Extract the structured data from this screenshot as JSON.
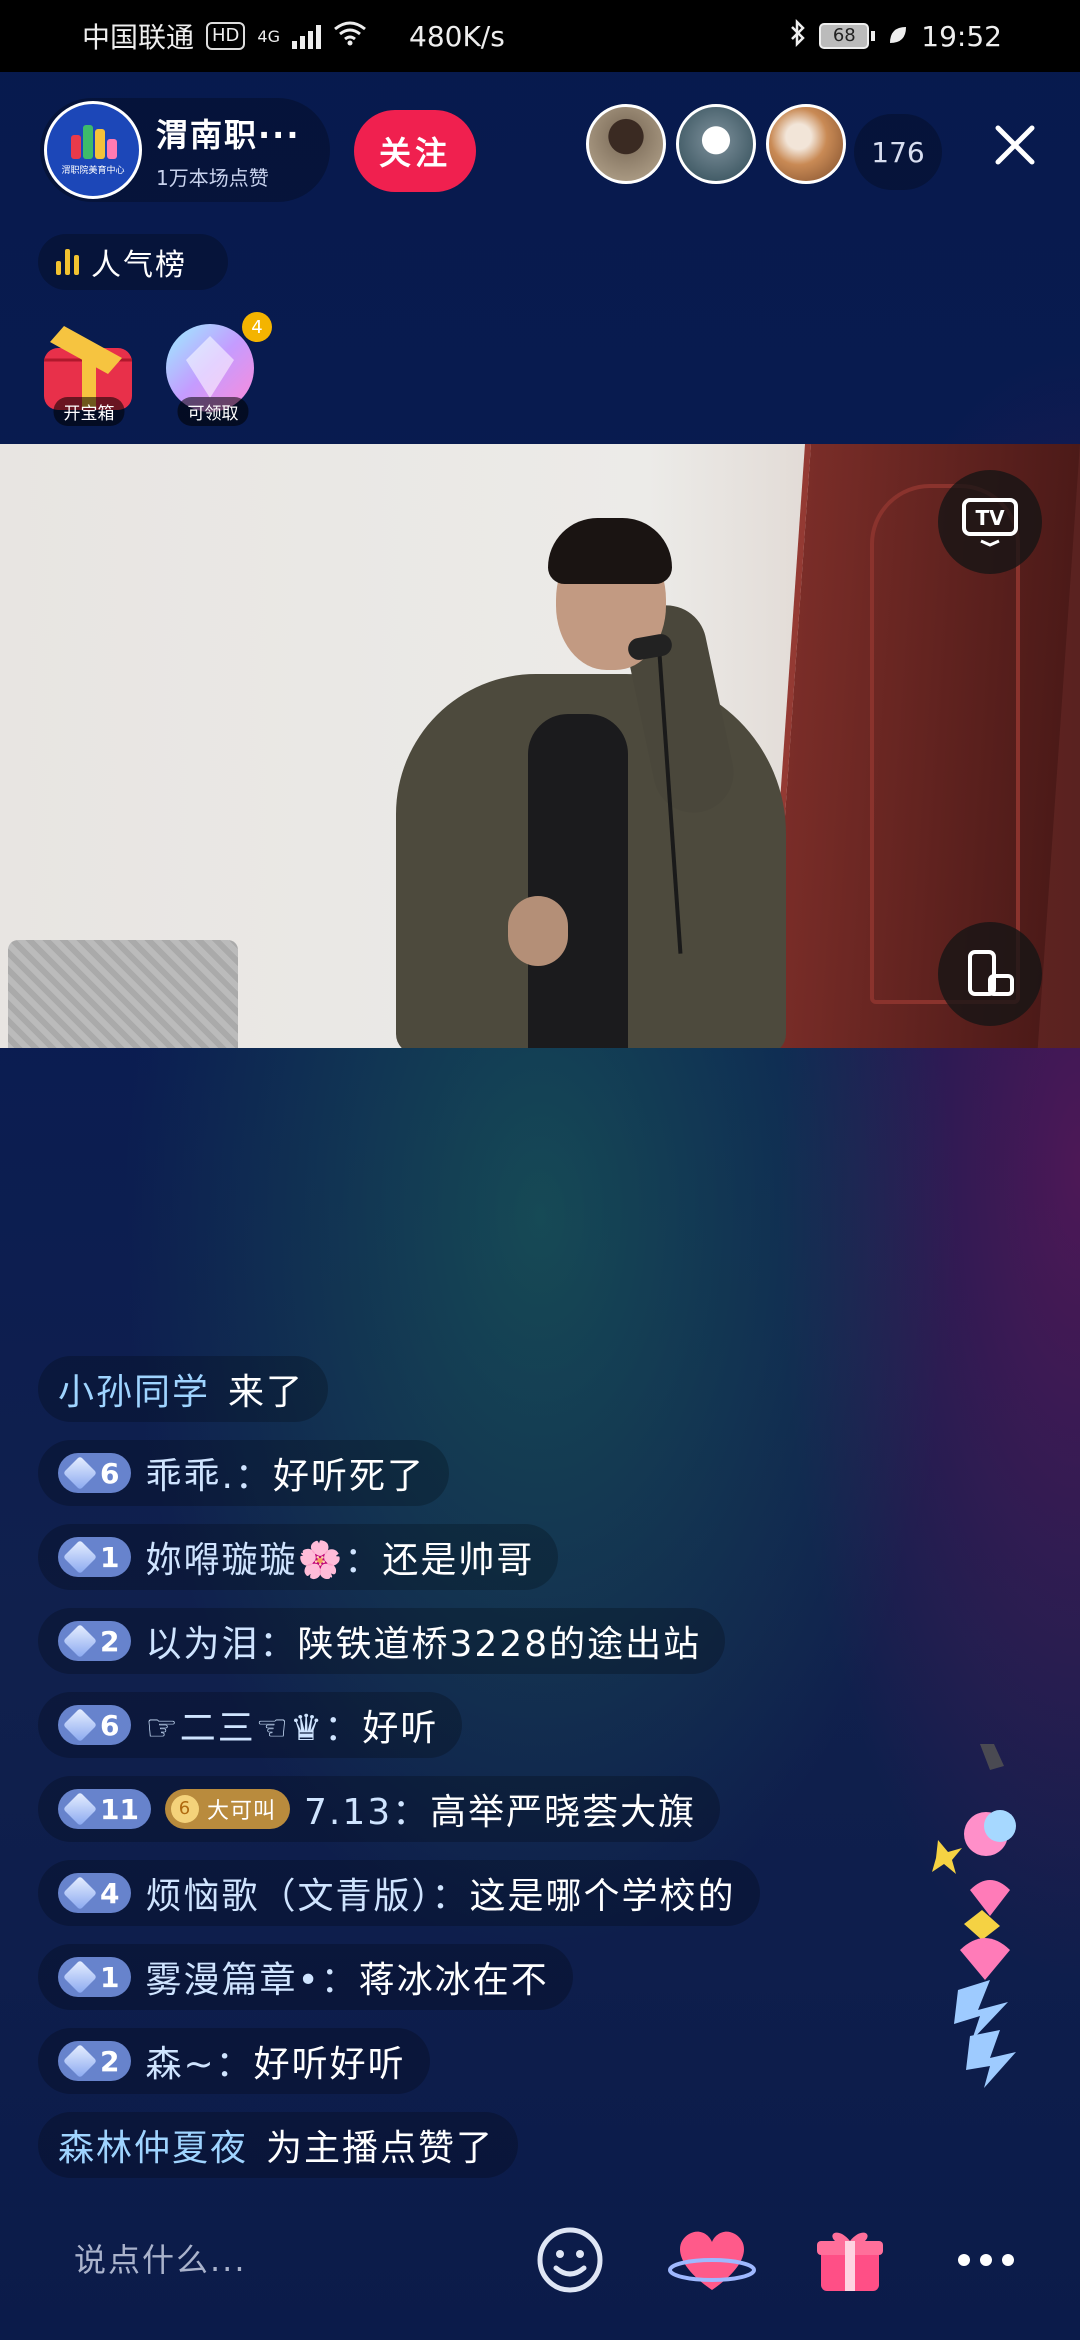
{
  "status_bar": {
    "carrier": "中国联通",
    "hd": "HD",
    "network": "4G",
    "speed": "480K/s",
    "battery": "68",
    "time": "19:52"
  },
  "header": {
    "host_name": "渭南职···",
    "host_likes": "1万本场点赞",
    "host_avatar_text": "渭职院美育中心",
    "follow_label": "关注",
    "viewer_count": "176"
  },
  "rank": {
    "label": "人气榜"
  },
  "boxes": [
    {
      "label": "开宝箱"
    },
    {
      "label": "可领取",
      "badge": "4"
    }
  ],
  "chat": {
    "faded": "",
    "messages": [
      {
        "type": "system",
        "nick": "小孙同学",
        "action": "来了"
      },
      {
        "type": "msg",
        "level": "6",
        "nick": "乖乖.：",
        "text": "好听死了"
      },
      {
        "type": "msg",
        "level": "1",
        "nick": "妳嘚璇璇🌸：",
        "text": "还是帅哥"
      },
      {
        "type": "msg",
        "level": "2",
        "nick": "以为泪：",
        "text": "陕铁道桥3228的途出站"
      },
      {
        "type": "msg",
        "level": "6",
        "nick": "☞二三☜♛：",
        "text": "好听"
      },
      {
        "type": "fan",
        "level": "11",
        "fan_level": "6",
        "fan_name": "大可叫",
        "nick": "7.13：",
        "text": "高举严晓荟大旗"
      },
      {
        "type": "msg",
        "level": "4",
        "nick": "烦恼歌（文青版）：",
        "text": "这是哪个学校的"
      },
      {
        "type": "msg",
        "level": "1",
        "nick": "雾漫篇章•：",
        "text": "蒋冰冰在不"
      },
      {
        "type": "msg",
        "level": "2",
        "nick": "森~：",
        "text": "好听好听"
      },
      {
        "type": "system",
        "nick": "森林仲夏夜",
        "action": "为主播点赞了"
      }
    ]
  },
  "bottom": {
    "input_placeholder": "说点什么..."
  },
  "icons": {
    "close": "close-icon",
    "tv": "tv-cast-icon",
    "rotate": "screen-rotate-icon",
    "emoji": "emoji-icon",
    "like": "heart-planet-icon",
    "gift": "gift-icon",
    "more": "more-icon"
  },
  "colors": {
    "follow": "#f0204f",
    "level_badge": "#7896e6",
    "rank_bars": "#f2c230"
  }
}
